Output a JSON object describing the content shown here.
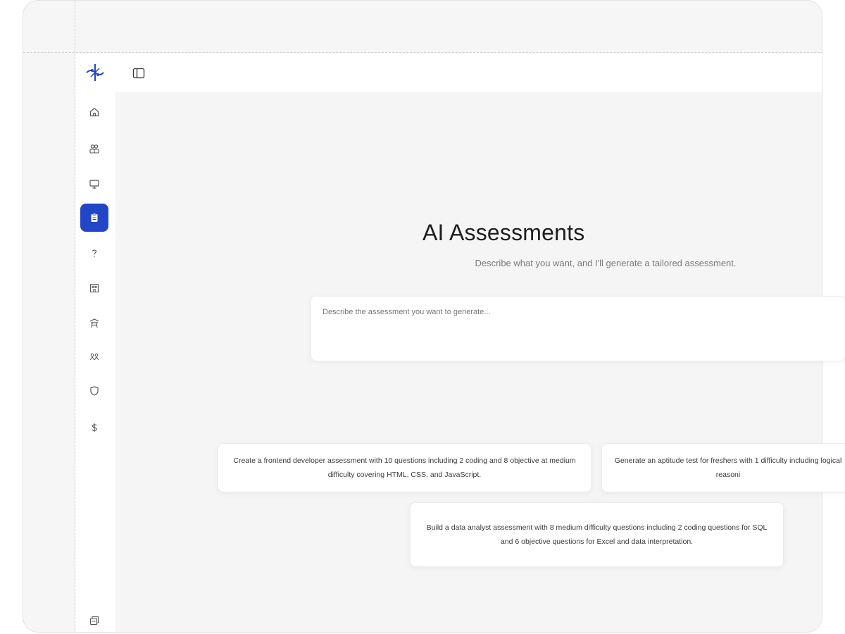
{
  "theme": {
    "accent": "#2346c8",
    "background": "#f5f5f5"
  },
  "sidebar": {
    "logo_icon": "brand-logo",
    "items": [
      {
        "icon": "home-icon",
        "active": false
      },
      {
        "icon": "people-icon",
        "active": false
      },
      {
        "icon": "monitor-icon",
        "active": false
      },
      {
        "icon": "clipboard-icon",
        "active": true
      },
      {
        "icon": "question-icon",
        "active": false
      },
      {
        "icon": "building-icon",
        "active": false
      },
      {
        "icon": "pagoda-icon",
        "active": false
      },
      {
        "icon": "team-icon",
        "active": false
      },
      {
        "icon": "shield-icon",
        "active": false
      },
      {
        "icon": "dollar-icon",
        "active": false
      }
    ],
    "bottom_icon": "switch-account-icon"
  },
  "topbar": {
    "toggle_icon": "sidebar-toggle-icon"
  },
  "main": {
    "title": "AI Assessments",
    "subtitle": "Describe what you want, and I'll generate a tailored assessment.",
    "prompt_placeholder": "Describe the assessment you want to generate...",
    "suggestions": [
      {
        "text": "Create a frontend developer assessment with 10 questions including 2 coding and 8 objective at medium difficulty covering HTML, CSS, and JavaScript."
      },
      {
        "text": "Generate an aptitude test for freshers with 1 difficulty including logical reasoni"
      },
      {
        "text": "Build a data analyst assessment with 8 medium difficulty questions including 2 coding questions for SQL and 6 objective questions for Excel and data interpretation."
      }
    ]
  }
}
